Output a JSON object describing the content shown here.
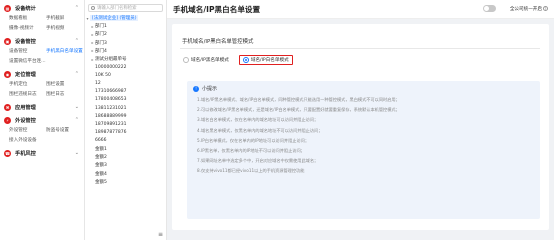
{
  "nav": {
    "groups": [
      {
        "icon": "grid-icon",
        "title": "设备统计",
        "rows": [
          [
            "数据看板",
            "手机截屏"
          ],
          [
            "摄像-视频计",
            "手机视频"
          ]
        ]
      },
      {
        "icon": "device-icon",
        "title": "设备管控",
        "rows": [
          [
            "设备管控",
            "手机黑白名单设置"
          ],
          [
            "设置微信平台连..."
          ]
        ]
      },
      {
        "icon": "location-icon",
        "title": "定位管理",
        "rows": [
          [
            "手机定位",
            "围栏设置"
          ],
          [
            "围栏违规日志",
            "围栏日志"
          ]
        ]
      },
      {
        "icon": "network-icon",
        "title": "应用管理",
        "rows": []
      },
      {
        "icon": "plug-icon",
        "title": "外设管控",
        "rows": [
          [
            "外设管控",
            "防盗号设置"
          ],
          [
            "接入外设设备"
          ]
        ]
      },
      {
        "icon": "phone-icon",
        "title": "手机风控",
        "rows": []
      }
    ]
  },
  "tree": {
    "search_placeholder": "请输入部门名称检索",
    "root": "[法测试企业] (管理员)",
    "folders": [
      "部门1",
      "部门2",
      "部门3",
      "部门4",
      "测试分组最单号"
    ],
    "items": [
      "10000000222",
      "10K 50",
      "12",
      "17310666987",
      "17800408653",
      "13811231021",
      "18688889999",
      "18709891231",
      "18987877876",
      "6666",
      "金额1",
      "金额2",
      "金额3",
      "金额4",
      "金额5"
    ],
    "collapse_icon": "≡"
  },
  "main": {
    "title": "手机域名/IP黑白名单设置",
    "toggle_label": "全公司统一开启",
    "section_title": "手机域名/IP黑白名单管控模式",
    "radio_black": "域名/IP黑名单模式",
    "radio_white": "域名/IP白名单模式",
    "tips_title": "小提示",
    "tips": [
      "1.域名/IP黑名单模式、域名/IP白名单模式，同种管控模式只能选用一种管控模式，黑白模式不可以同时启用；",
      "2.可以修改域名/IP黑名单模式，还是域名/IP白名单模式，只要配置好就要重复保存，系统默认本机管控模式；",
      "3.域名白名单模式，仅在名单内的域名地址可以访问并阻止访问；",
      "4.域名黑名单模式，仅黑名单内的域名地址不可以访问并阻止访问；",
      "5.IP白名单模式，仅在名单内的IP地址可以访问并阻止访问；",
      "6.IP黑名单，仅黑名单内的IP地址不可以访问并阻止访问；",
      "7.如果网址名单中选定多个中，开启对应域名中仅需使用此域名；",
      "8.仅支持vivo11都已经vivo11以上的手机资源管理控功能"
    ]
  }
}
